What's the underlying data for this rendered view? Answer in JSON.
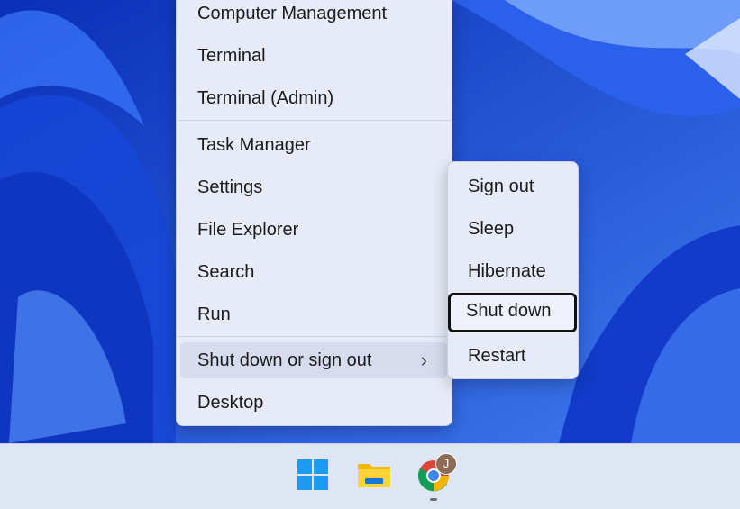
{
  "menu": {
    "items": [
      {
        "label": "Computer Management"
      },
      {
        "label": "Terminal"
      },
      {
        "label": "Terminal (Admin)"
      },
      {
        "label": "Task Manager"
      },
      {
        "label": "Settings"
      },
      {
        "label": "File Explorer"
      },
      {
        "label": "Search"
      },
      {
        "label": "Run"
      },
      {
        "label": "Shut down or sign out"
      },
      {
        "label": "Desktop"
      }
    ],
    "chevron": "›"
  },
  "submenu": {
    "items": [
      {
        "label": "Sign out"
      },
      {
        "label": "Sleep"
      },
      {
        "label": "Hibernate"
      },
      {
        "label": "Shut down"
      },
      {
        "label": "Restart"
      }
    ]
  },
  "taskbar": {
    "icons": [
      "windows-start-icon",
      "file-explorer-icon",
      "chrome-icon"
    ],
    "profile_badge": "J"
  },
  "colors": {
    "menu_bg": "#e6ebf7",
    "wallpaper": "#1f4fd1",
    "taskbar_bg": "#dfe6f3"
  }
}
